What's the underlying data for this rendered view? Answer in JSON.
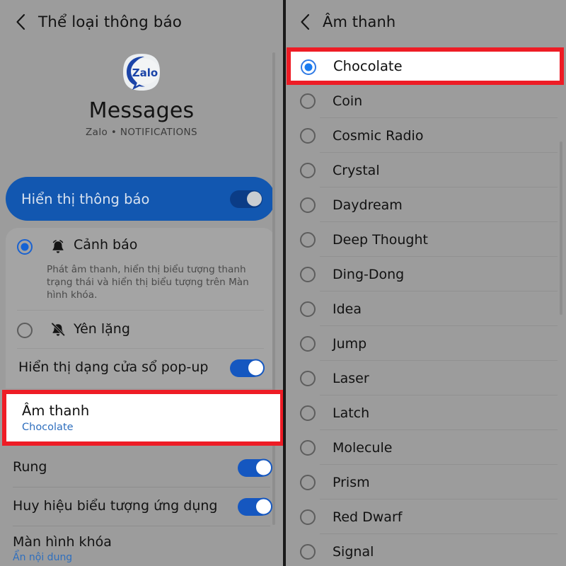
{
  "colors": {
    "background": "#9c9c9c",
    "highlight_red": "#ee1c25",
    "accent_blue": "#1557c0",
    "banner_blue": "#1257b0",
    "link_blue": "#2f6fbe",
    "card_gray": "#a4a4a4",
    "white": "#ffffff"
  },
  "left_panel": {
    "header": {
      "back_icon": "chevron-left-icon",
      "title": "Thể loại thông báo"
    },
    "app": {
      "logo_icon": "zalo-app-logo",
      "logo_text": "Zalo",
      "name": "Messages",
      "subtitle": "Zalo • NOTIFICATIONS"
    },
    "master_toggle": {
      "label": "Hiển thị thông báo",
      "state": "on"
    },
    "alert_options": [
      {
        "label": "Cảnh báo",
        "description": "Phát âm thanh, hiển thị biểu tượng thanh trạng thái và hiển thị biểu tượng trên Màn hình khóa.",
        "icon": "bell-ringing-icon",
        "selected": true
      },
      {
        "label": "Yên lặng",
        "description": "",
        "icon": "bell-muted-icon",
        "selected": false
      }
    ],
    "rows": [
      {
        "title": "Hiển thị dạng cửa sổ pop-up",
        "subtitle": "",
        "control": "toggle",
        "state": "on"
      },
      {
        "title": "Âm thanh",
        "subtitle": "Chocolate",
        "control": "none",
        "state": "",
        "highlighted": true
      },
      {
        "title": "Rung",
        "subtitle": "",
        "control": "toggle",
        "state": "on"
      },
      {
        "title": "Huy hiệu biểu tượng ứng dụng",
        "subtitle": "",
        "control": "toggle",
        "state": "on"
      },
      {
        "title": "Màn hình khóa",
        "subtitle": "Ẩn nội dung",
        "control": "none",
        "state": ""
      }
    ]
  },
  "right_panel": {
    "header": {
      "back_icon": "chevron-left-icon",
      "title": "Âm thanh"
    },
    "selected_sound": "Chocolate",
    "sounds": [
      {
        "label": "Chocolate",
        "selected": true,
        "highlighted": true
      },
      {
        "label": "Coin",
        "selected": false
      },
      {
        "label": "Cosmic Radio",
        "selected": false
      },
      {
        "label": "Crystal",
        "selected": false
      },
      {
        "label": "Daydream",
        "selected": false
      },
      {
        "label": "Deep Thought",
        "selected": false
      },
      {
        "label": "Ding-Dong",
        "selected": false
      },
      {
        "label": "Idea",
        "selected": false
      },
      {
        "label": "Jump",
        "selected": false
      },
      {
        "label": "Laser",
        "selected": false
      },
      {
        "label": "Latch",
        "selected": false
      },
      {
        "label": "Molecule",
        "selected": false
      },
      {
        "label": "Prism",
        "selected": false
      },
      {
        "label": "Red Dwarf",
        "selected": false
      },
      {
        "label": "Signal",
        "selected": false
      }
    ]
  }
}
